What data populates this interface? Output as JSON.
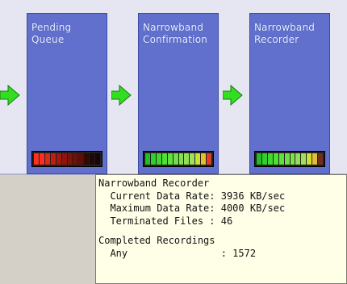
{
  "colors": {
    "stage_fill": "#6070cc",
    "pipeline_bg": "#e6e6f2",
    "arrow": "#33dd22",
    "tooltip_bg": "#ffffe8"
  },
  "stages": [
    {
      "title_line1": "Pending",
      "title_line2": "Queue",
      "meter": [
        "#ff3020",
        "#ff3020",
        "#e02818",
        "#c02010",
        "#a01810",
        "#901408",
        "#801208",
        "#701008",
        "#600e08",
        "#300a08",
        "#200808",
        "#180606"
      ]
    },
    {
      "title_line1": "Narrowband",
      "title_line2": "Confirmation",
      "meter": [
        "#20c020",
        "#30d030",
        "#40d830",
        "#50e030",
        "#60e040",
        "#70e040",
        "#80e050",
        "#90e050",
        "#a0e060",
        "#d0e030",
        "#e0c030",
        "#e04020"
      ]
    },
    {
      "title_line1": "Narrowband",
      "title_line2": "Recorder",
      "meter": [
        "#20c020",
        "#30d030",
        "#40d830",
        "#50e030",
        "#60e040",
        "#70e040",
        "#80e050",
        "#90e050",
        "#a0e060",
        "#d0e030",
        "#e0c030",
        "#703020"
      ]
    }
  ],
  "tooltip": {
    "title": "Narrowband Recorder",
    "current_rate": "  Current Data Rate: 3936 KB/sec",
    "max_rate": "  Maximum Data Rate: 4000 KB/sec",
    "terminated": "  Terminated Files : 46",
    "section": "Completed Recordings",
    "any_row": "  Any                : 1572"
  }
}
